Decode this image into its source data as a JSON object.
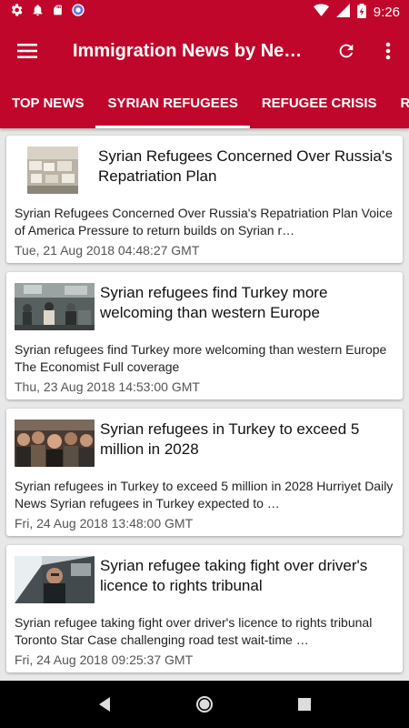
{
  "status_bar": {
    "time": "9:26",
    "icons": [
      "settings-icon",
      "notification-icon",
      "sd-card-icon",
      "sync-icon",
      "wifi-icon",
      "signal-icon",
      "battery-icon"
    ]
  },
  "app_bar": {
    "title": "Immigration News by Ne…",
    "icons": [
      "menu-icon",
      "refresh-icon",
      "more-vert-icon"
    ]
  },
  "tabs": [
    {
      "label": "TOP NEWS",
      "active": false
    },
    {
      "label": "SYRIAN REFUGEES",
      "active": true
    },
    {
      "label": "REFUGEE CRISIS",
      "active": false
    },
    {
      "label": "REFU",
      "active": false
    }
  ],
  "articles": [
    {
      "title": "Syrian Refugees Concerned Over Russia's Repatriation Plan",
      "description": "Syrian Refugees Concerned Over Russia's Repatriation Plan  Voice of America  Pressure to return builds on Syrian r…",
      "date": "Tue, 21 Aug 2018 04:48:27 GMT"
    },
    {
      "title": "Syrian refugees find Turkey more welcoming than western Europe",
      "description": "Syrian refugees find Turkey more welcoming than western Europe  The Economist  Full coverage",
      "date": "Thu, 23 Aug 2018 14:53:00 GMT"
    },
    {
      "title": "Syrian refugees in Turkey to exceed 5 million in 2028",
      "description": "Syrian refugees in Turkey to exceed 5 million in 2028  Hurriyet Daily News  Syrian refugees in Turkey expected to …",
      "date": "Fri, 24 Aug 2018 13:48:00 GMT"
    },
    {
      "title": "Syrian refugee taking fight over driver's licence to rights tribunal",
      "description": "Syrian refugee taking fight over driver's licence to rights tribunal  Toronto Star  Case challenging road test wait-time …",
      "date": "Fri, 24 Aug 2018 09:25:37 GMT"
    }
  ],
  "colors": {
    "primary": "#c0072b",
    "background": "#e8e8e8",
    "card": "#ffffff"
  }
}
